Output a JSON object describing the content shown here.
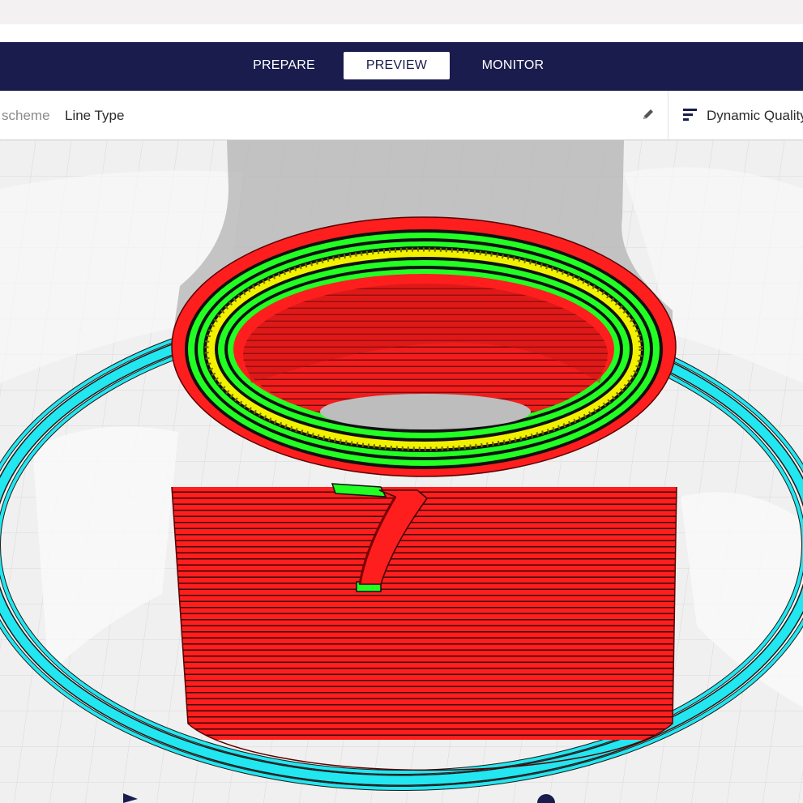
{
  "stage_tabs": [
    {
      "label": "PREPARE",
      "active": false
    },
    {
      "label": "PREVIEW",
      "active": true
    },
    {
      "label": "MONITOR",
      "active": false
    }
  ],
  "view_settings": {
    "color_scheme_label": "scheme",
    "color_scheme_value": "Line Type",
    "edit_icon": "pencil-icon"
  },
  "profile": {
    "icon": "profile-icon",
    "label": "Dynamic Quality"
  },
  "model": {
    "label": "7"
  },
  "colors": {
    "header": "#191c4d",
    "wall_outer": "#ff1e1e",
    "wall_inner": "#22ff22",
    "infill": "#f2f200",
    "skirt": "#22e6f0",
    "layer_slider_handle": "#191c4d"
  }
}
